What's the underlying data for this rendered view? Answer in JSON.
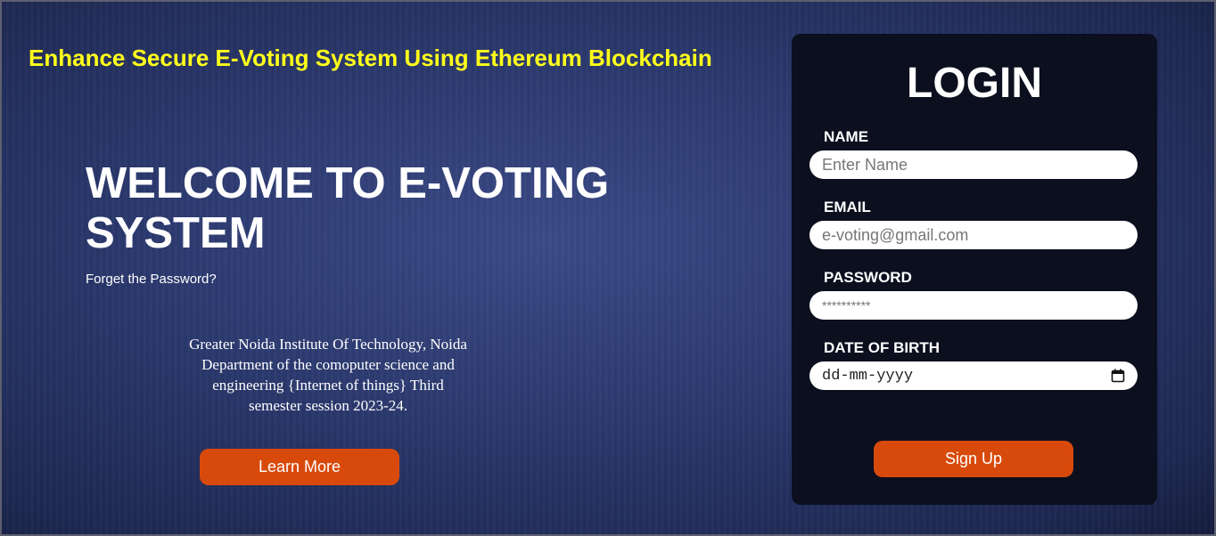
{
  "header": {
    "site_title": "Enhance Secure E-Voting System Using Ethereum Blockchain"
  },
  "hero": {
    "welcome": "WELCOME TO E-VOTING SYSTEM",
    "forgot_link": "Forget the Password?",
    "institute_lines": [
      "Greater Noida Institute Of Technology, Noida",
      "Department of the comoputer science and",
      "engineering {Internet of things} Third",
      "semester session 2023-24."
    ],
    "learn_more": "Learn More"
  },
  "login": {
    "title": "LOGIN",
    "name_label": "NAME",
    "name_placeholder": "Enter Name",
    "email_label": "EMAIL",
    "email_placeholder": "e-voting@gmail.com",
    "password_label": "PASSWORD",
    "password_placeholder": "**********",
    "dob_label": "DATE OF BIRTH",
    "dob_placeholder": "dd-mm-yyyy",
    "signup": "Sign Up"
  },
  "colors": {
    "title_yellow": "#ffff1a",
    "button_orange": "#d84a0c",
    "panel_bg": "#0b0f1e"
  }
}
